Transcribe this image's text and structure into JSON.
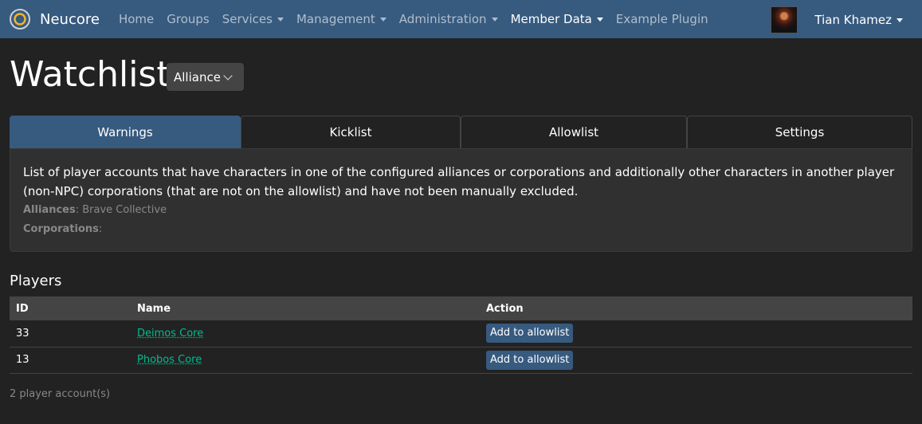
{
  "navbar": {
    "brand": "Neucore",
    "items": [
      {
        "label": "Home",
        "dropdown": false,
        "active": false
      },
      {
        "label": "Groups",
        "dropdown": false,
        "active": false
      },
      {
        "label": "Services",
        "dropdown": true,
        "active": false
      },
      {
        "label": "Management",
        "dropdown": true,
        "active": false
      },
      {
        "label": "Administration",
        "dropdown": true,
        "active": false
      },
      {
        "label": "Member Data",
        "dropdown": true,
        "active": true
      },
      {
        "label": "Example Plugin",
        "dropdown": false,
        "active": false
      }
    ],
    "user_name": "Tian Khamez"
  },
  "page": {
    "title": "Watchlist",
    "select_value": "Alliance"
  },
  "tabs": [
    {
      "label": "Warnings",
      "active": true
    },
    {
      "label": "Kicklist",
      "active": false
    },
    {
      "label": "Allowlist",
      "active": false
    },
    {
      "label": "Settings",
      "active": false
    }
  ],
  "info": {
    "description": "List of player accounts that have characters in one of the configured alliances or corporations and additionally other characters in another player (non-NPC) corporations (that are not on the allowlist) and have not been manually excluded.",
    "alliances_label": "Alliances",
    "alliances_value": "Brave Collective",
    "corporations_label": "Corporations",
    "corporations_value": ""
  },
  "players": {
    "title": "Players",
    "columns": {
      "id": "ID",
      "name": "Name",
      "action": "Action"
    },
    "rows": [
      {
        "id": "33",
        "name": "Deimos Core",
        "action": "Add to allowlist"
      },
      {
        "id": "13",
        "name": "Phobos Core",
        "action": "Add to allowlist"
      }
    ],
    "count_text": "2 player account(s)"
  },
  "colors": {
    "navbar": "#375a7f",
    "background": "#222222",
    "link": "#00bc8c",
    "button": "#375a7f"
  }
}
